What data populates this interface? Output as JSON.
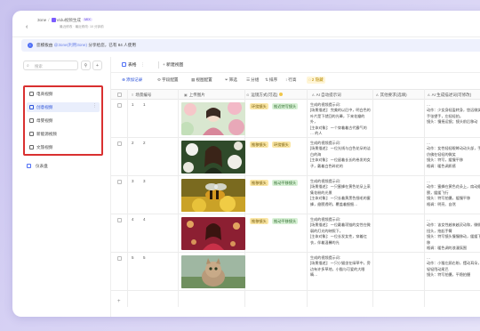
{
  "header": {
    "back_icon": "chevron-left-icon",
    "crumb_root": "3one",
    "crumb_project": "Vidu视频生成",
    "crumb_tag": "MIX",
    "crumb_meta_a": "最近修改",
    "crumb_meta_b": "最近修改: 10 分钟前"
  },
  "notice": {
    "icon": "info-icon",
    "prefix": "您模板由",
    "highlight": "@3one(利用3one)",
    "suffix": "分享给您，已有 84 人使用"
  },
  "sidebar": {
    "search_placeholder": "搜索",
    "search_icon": "search-icon",
    "filter_icon": "filter-icon",
    "add_icon": "plus-icon",
    "views": [
      {
        "label": "电商视频",
        "icon": "table-icon",
        "active": false
      },
      {
        "label": "创意视频",
        "icon": "table-icon",
        "active": true
      },
      {
        "label": "母婴视频",
        "icon": "table-icon",
        "active": false
      },
      {
        "label": "新能源视频",
        "icon": "table-icon",
        "active": false
      },
      {
        "label": "文旅视频",
        "icon": "table-icon",
        "active": false
      }
    ],
    "more_icon": "more-vertical-icon",
    "dashboard_label": "仪表盘"
  },
  "main": {
    "tab_label": "表格",
    "tab_icon": "grid-icon",
    "new_view_label": "新建视图",
    "toolbar": {
      "add_record": "添加记录",
      "field_config": "字段配置",
      "view_config": "视图配置",
      "filter": "筛选",
      "group": "分组",
      "sort": "排序",
      "row_height": "行高",
      "hidden_fields": "2 隐藏"
    },
    "columns": {
      "index": "",
      "scene_no": "场景编号",
      "image": "上传图片",
      "camera": "运镜方式(可选)",
      "prompt": "AI 自动提示词",
      "other": "其他要求(选填)",
      "refs": "AI 生成描述词(可修改)"
    },
    "rows": [
      {
        "index": "1",
        "scene": "1",
        "image_alt": "portrait-with-flowers",
        "tags": [
          "环绕镜头",
          "推近特写镜头"
        ],
        "prompt": "生成的视频提示词:\n[场景描述]：完美的以后中，明白色的叶片是下就回的光晕，下来花瓣的外，\n[主体对象]：一个穿着着古代霸气的 … 的人",
        "refs": "…\n动作：少女身轻盈转身，悠远微笑手张望手，左轻轻拍。\n镜头：慢摇运镜；镜头前后移动"
      },
      {
        "index": "2",
        "scene": "2",
        "image_alt": "woman-with-white-flowers",
        "tags": [
          "推移镜头",
          "环绕镜头"
        ],
        "prompt": "生成的视频提示词:\n[场景描述]：一位光线与白色花朵的洁白的海\n[主体对象]：一位留着长长的卷发的女子，戴着白色碎花的",
        "refs": "…\n动作：女性轻轻眼眸动动头部，手仿佛在轻轻的微笑\n镜头：特写，缓慢平移\n格调：暖色调质感"
      },
      {
        "index": "3",
        "scene": "3",
        "image_alt": "bee-on-flower",
        "tags": [
          "推移镜头",
          "推动平移镜头"
        ],
        "prompt": "生成的视频提示词:\n[场景描述]：一只蜜蜂在黄色花朵上采集花粉的光景\n[主体对象]：一只长着黄黑色细毛的蜜蜂，翅膀透明，覆盖着细细…",
        "refs": "…\n动作：蜜蜂在黄色花朵上，扇动翅膀，缓缓飞行\n镜头：特写拍摄，缓慢平移\n格调：明亮、自然"
      },
      {
        "index": "4",
        "scene": "4",
        "image_alt": "woman-in-red-light",
        "tags": [
          "推移镜头",
          "推动平移镜头"
        ],
        "prompt": "生成的视频提示词:\n[场景描述]：一位戴着项链的女性在微弱的灯光的映照下，\n[主体对象]：一位长发女性，穿着红衣，伴着温馨的光",
        "refs": "…\n动作：该女性越来越灵动和，微微扭头，抬起手臂\n镜头：特写镜头慢慢移动，缓缓下移\n格调：暖色调的浪漫氛围"
      },
      {
        "index": "5",
        "scene": "5",
        "image_alt": "cat-outdoors",
        "tags": [],
        "prompt": "生成的视频提示词:\n[场景描述]：一只小猫坐在绿草中，旁边有许多草地，小猫与可爱的大眼睛…",
        "refs": "…\n动作：小猫左顾右盼，摆动耳朵，轻轻甩动尾巴\n镜头：特写拍摄，平稳拍摄"
      }
    ]
  }
}
